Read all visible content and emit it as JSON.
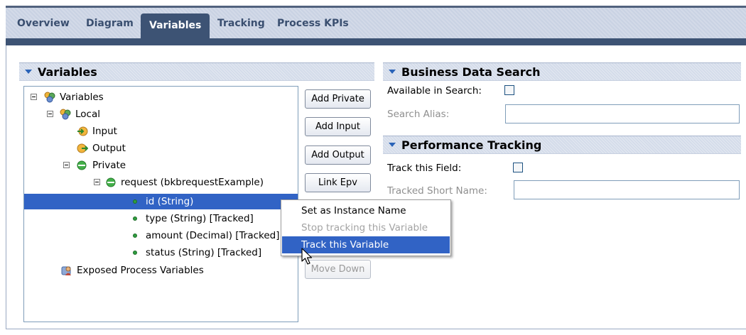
{
  "tabs": [
    "Overview",
    "Diagram",
    "Variables",
    "Tracking",
    "Process KPIs"
  ],
  "active_tab": "Variables",
  "variables_section": {
    "title": "Variables",
    "tree": [
      {
        "label": "Variables"
      },
      {
        "label": "Local"
      },
      {
        "label": "Input"
      },
      {
        "label": "Output"
      },
      {
        "label": "Private"
      },
      {
        "label": "request (bkbrequestExample)"
      },
      {
        "label": "id (String)"
      },
      {
        "label": "type (String) [Tracked]"
      },
      {
        "label": "amount (Decimal) [Tracked]"
      },
      {
        "label": "status (String) [Tracked]"
      },
      {
        "label": "Exposed Process Variables"
      }
    ],
    "buttons": {
      "add_private": "Add Private",
      "add_input": "Add Input",
      "add_output": "Add Output",
      "link_epv": "Link Epv",
      "move_down": "Move Down"
    }
  },
  "business_data_search": {
    "title": "Business Data Search",
    "available_label": "Available in Search:",
    "alias_label": "Search Alias:",
    "alias_value": ""
  },
  "performance_tracking": {
    "title": "Performance Tracking",
    "track_label": "Track this Field:",
    "short_name_label": "Tracked Short Name:",
    "short_name_value": ""
  },
  "context_menu": {
    "items": [
      "Set as Instance Name",
      "Stop tracking this Variable",
      "Track this Variable"
    ]
  },
  "colors": {
    "selection": "#3163c5",
    "tab_active": "#3d5374",
    "header_bg": "#d4dcea"
  }
}
